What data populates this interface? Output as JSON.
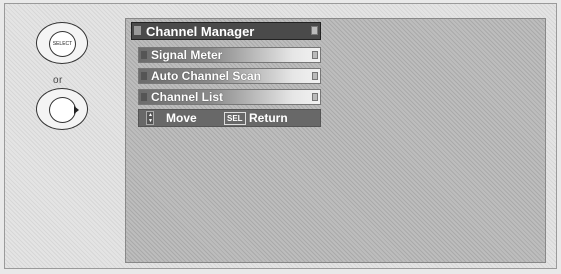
{
  "remote": {
    "select_button_label": "SELECT",
    "or_label": "or"
  },
  "menu": {
    "title": "Channel Manager",
    "items": [
      {
        "label": "Signal Meter"
      },
      {
        "label": "Auto Channel Scan"
      },
      {
        "label": "Channel List"
      }
    ]
  },
  "footer": {
    "move_label": "Move",
    "sel_key": "SEL",
    "return_label": "Return"
  }
}
